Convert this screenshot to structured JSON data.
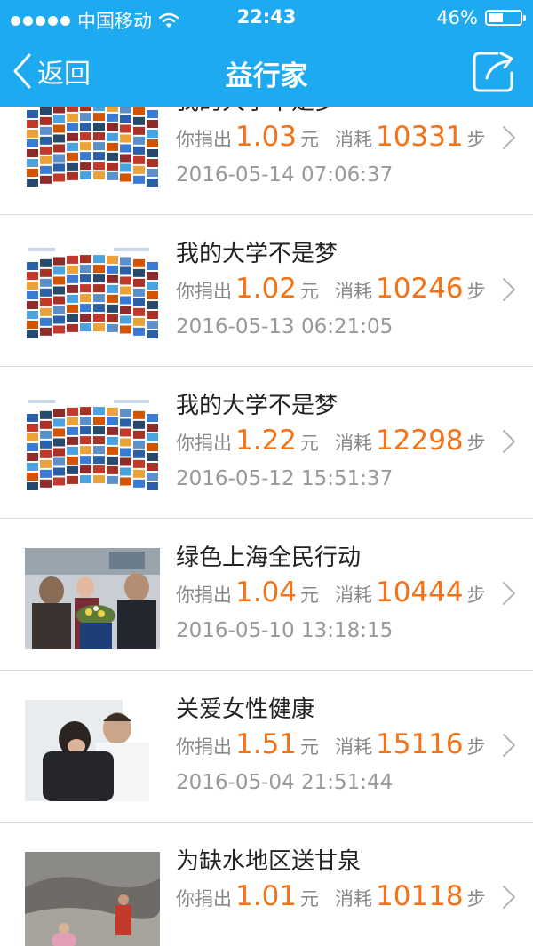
{
  "status_bar": {
    "carrier": "中国移动",
    "time": "22:43",
    "battery_percent": "46%",
    "battery_level": 0.46
  },
  "nav": {
    "back_label": "返回",
    "title": "益行家"
  },
  "labels": {
    "donate": "你捐出",
    "yuan": "元",
    "consume": "消耗",
    "steps": "步"
  },
  "items": [
    {
      "title": "我的大学不是梦",
      "amount": "1.03",
      "steps": "10331",
      "date": "2016-05-14 07:06:37",
      "thumb": "collage"
    },
    {
      "title": "我的大学不是梦",
      "amount": "1.02",
      "steps": "10246",
      "date": "2016-05-13 06:21:05",
      "thumb": "collage"
    },
    {
      "title": "我的大学不是梦",
      "amount": "1.22",
      "steps": "12298",
      "date": "2016-05-12 15:51:37",
      "thumb": "collage"
    },
    {
      "title": "绿色上海全民行动",
      "amount": "1.04",
      "steps": "10444",
      "date": "2016-05-10 13:18:15",
      "thumb": "crowd"
    },
    {
      "title": "关爱女性健康",
      "amount": "1.51",
      "steps": "15116",
      "date": "2016-05-04 21:51:44",
      "thumb": "hug"
    },
    {
      "title": "为缺水地区送甘泉",
      "amount": "1.01",
      "steps": "10118",
      "date": "",
      "thumb": "dry"
    }
  ],
  "colors": {
    "brand": "#1eaaf1",
    "accent": "#f57216"
  }
}
